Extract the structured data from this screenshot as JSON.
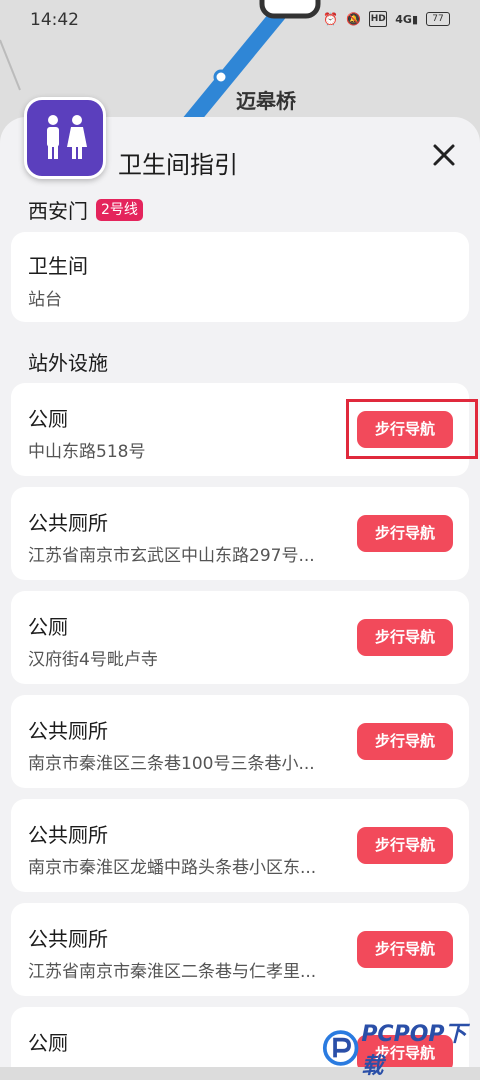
{
  "status_bar": {
    "time": "14:42",
    "icons": [
      "alarm-icon",
      "mute-icon",
      "hd-icon",
      "signal-icon",
      "battery-icon"
    ],
    "hd_label": "HD",
    "network_label": "4G",
    "battery_level": "77"
  },
  "map": {
    "station_label": "迈皋桥",
    "line_color": "#2f86d6"
  },
  "sheet": {
    "title": "卫生间指引",
    "close_icon": "close-icon",
    "app_icon": "restroom-icon",
    "app_icon_color": "#5b3fbd",
    "station_name": "西安门",
    "line_badge": "2号线",
    "line_badge_color": "#e4245c",
    "inside": {
      "title": "卫生间",
      "location": "站台"
    },
    "outside_section_title": "站外设施",
    "outside_items": [
      {
        "name": "公厕",
        "address": "中山东路518号",
        "button": "步行导航"
      },
      {
        "name": "公共厕所",
        "address": "江苏省南京市玄武区中山东路297号...",
        "button": "步行导航"
      },
      {
        "name": "公厕",
        "address": "汉府街4号毗卢寺",
        "button": "步行导航"
      },
      {
        "name": "公共厕所",
        "address": "南京市秦淮区三条巷100号三条巷小...",
        "button": "步行导航"
      },
      {
        "name": "公共厕所",
        "address": "南京市秦淮区龙蟠中路头条巷小区东...",
        "button": "步行导航"
      },
      {
        "name": "公共厕所",
        "address": "江苏省南京市秦淮区二条巷与仁孝里...",
        "button": "步行导航"
      },
      {
        "name": "公厕",
        "address": "",
        "button": "步行导航"
      }
    ],
    "button_color": "#f24a5b"
  },
  "watermark": {
    "text": "PCPOP下载"
  }
}
